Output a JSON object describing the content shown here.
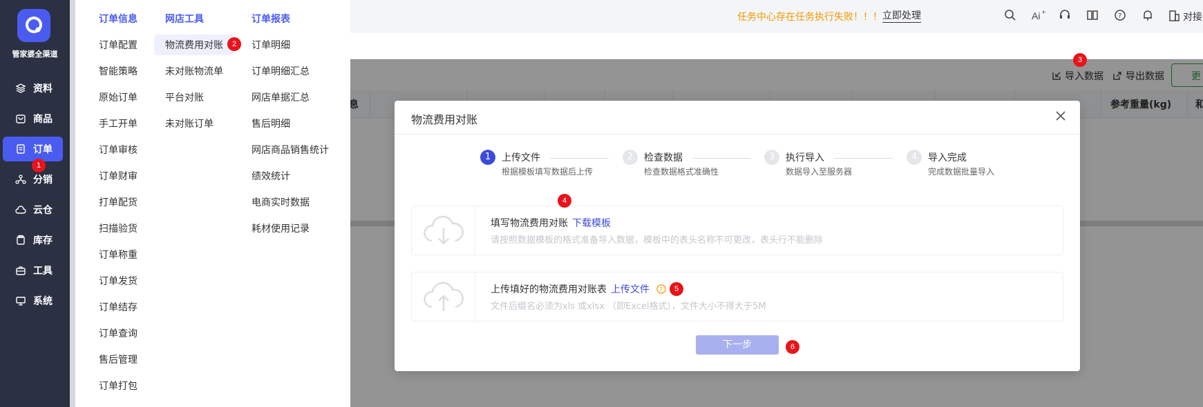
{
  "app": {
    "logo_text": "管家婆全渠道"
  },
  "sidebar": {
    "items": [
      {
        "label": "资料",
        "icon": "layers-icon"
      },
      {
        "label": "商品",
        "icon": "bag-icon"
      },
      {
        "label": "订单",
        "icon": "order-doc-icon",
        "active": true
      },
      {
        "label": "分销",
        "icon": "network-icon"
      },
      {
        "label": "云仓",
        "icon": "cloud-icon"
      },
      {
        "label": "库存",
        "icon": "stack-icon"
      },
      {
        "label": "工具",
        "icon": "toolbox-icon"
      },
      {
        "label": "系统",
        "icon": "monitor-icon"
      }
    ]
  },
  "header": {
    "warning_text": "任务中心存在任务执行失败！！！",
    "warning_action": "立即处理",
    "icons": [
      "search-icon",
      "ai-icon",
      "headset-icon",
      "book-icon",
      "help-icon",
      "bell-icon",
      "building-icon"
    ],
    "tail_text": "对接"
  },
  "toolbar": {
    "import_label": "导入数据",
    "export_label": "导出数据",
    "green_button_label": "更"
  },
  "table": {
    "headers_visible": [
      "息",
      "参考重量(kg)",
      "和"
    ]
  },
  "mega_menu": {
    "columns": [
      {
        "title": "订单信息",
        "items": [
          "订单配置",
          "智能策略",
          "原始订单",
          "手工开单",
          "订单审核",
          "订单财审",
          "打单配货",
          "扫描验货",
          "订单称重",
          "订单发货",
          "订单结存",
          "订单查询",
          "售后管理",
          "订单打包"
        ]
      },
      {
        "title": "网店工具",
        "items": [
          "物流费用对账",
          "未对账物流单",
          "平台对账",
          "未对账订单"
        ]
      },
      {
        "title": "订单报表",
        "items": [
          "订单明细",
          "订单明细汇总",
          "网店单据汇总",
          "售后明细",
          "网店商品销售统计",
          "绩效统计",
          "电商实时数据",
          "耗材使用记录"
        ]
      }
    ],
    "highlighted_item": "物流费用对账"
  },
  "dialog": {
    "title": "物流费用对账",
    "steps": [
      {
        "num": "1",
        "title": "上传文件",
        "desc": "根据模板填写数据后上传",
        "state": "active"
      },
      {
        "num": "2",
        "title": "检查数据",
        "desc": "检查数据格式准确性",
        "state": "todo"
      },
      {
        "num": "3",
        "title": "执行导入",
        "desc": "数据导入至服务器",
        "state": "todo"
      },
      {
        "num": "4",
        "title": "导入完成",
        "desc": "完成数据批量导入",
        "state": "todo"
      }
    ],
    "download_panel": {
      "title": "填写物流费用对账",
      "link": "下载模板",
      "subtitle": "请按照数据模板的格式准备导入数据，模板中的表头名称不可更改，表头行不能删除"
    },
    "upload_panel": {
      "title": "上传填好的物流费用对账表",
      "link": "上传文件",
      "subtitle": "文件后缀名必须为xls 或xlsx （即Excel格式），文件大小不得大于5M"
    },
    "next_button": "下一步"
  },
  "annotations": [
    "1",
    "2",
    "3",
    "4",
    "5",
    "6"
  ],
  "colors": {
    "sidebar_bg": "#2b3043",
    "accent": "#4a5cf0",
    "warning": "#f29900",
    "badge": "#e8141b"
  }
}
